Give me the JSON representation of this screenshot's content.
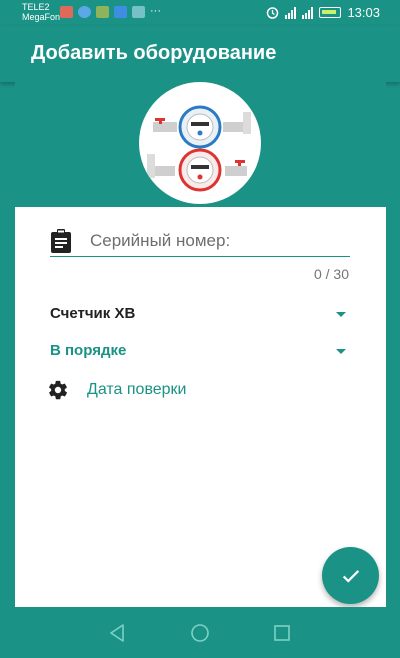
{
  "statusbar": {
    "carrier_line1": "TELE2",
    "carrier_line2": "MegaFon",
    "time": "13:03",
    "notification_icons": [
      "video-icon",
      "shield-icon",
      "tools-icon",
      "mail-icon",
      "image-icon"
    ],
    "more": "···"
  },
  "appbar": {
    "title": "Добавить оборудование"
  },
  "header_image": {
    "alt": "water-meters-photo"
  },
  "form": {
    "serial": {
      "placeholder": "Серийный номер:",
      "value": "",
      "counter": "0 / 30"
    },
    "meter_type": {
      "selected": "Счетчик ХВ"
    },
    "condition": {
      "selected": "В порядке"
    },
    "verification_date": {
      "label": "Дата поверки"
    }
  },
  "fab": {
    "icon": "check-icon"
  },
  "navbar": {
    "buttons": [
      "back-icon",
      "home-icon",
      "recents-icon"
    ]
  },
  "colors": {
    "primary": "#1a9285",
    "background": "#ffffff",
    "text": "#222222"
  }
}
